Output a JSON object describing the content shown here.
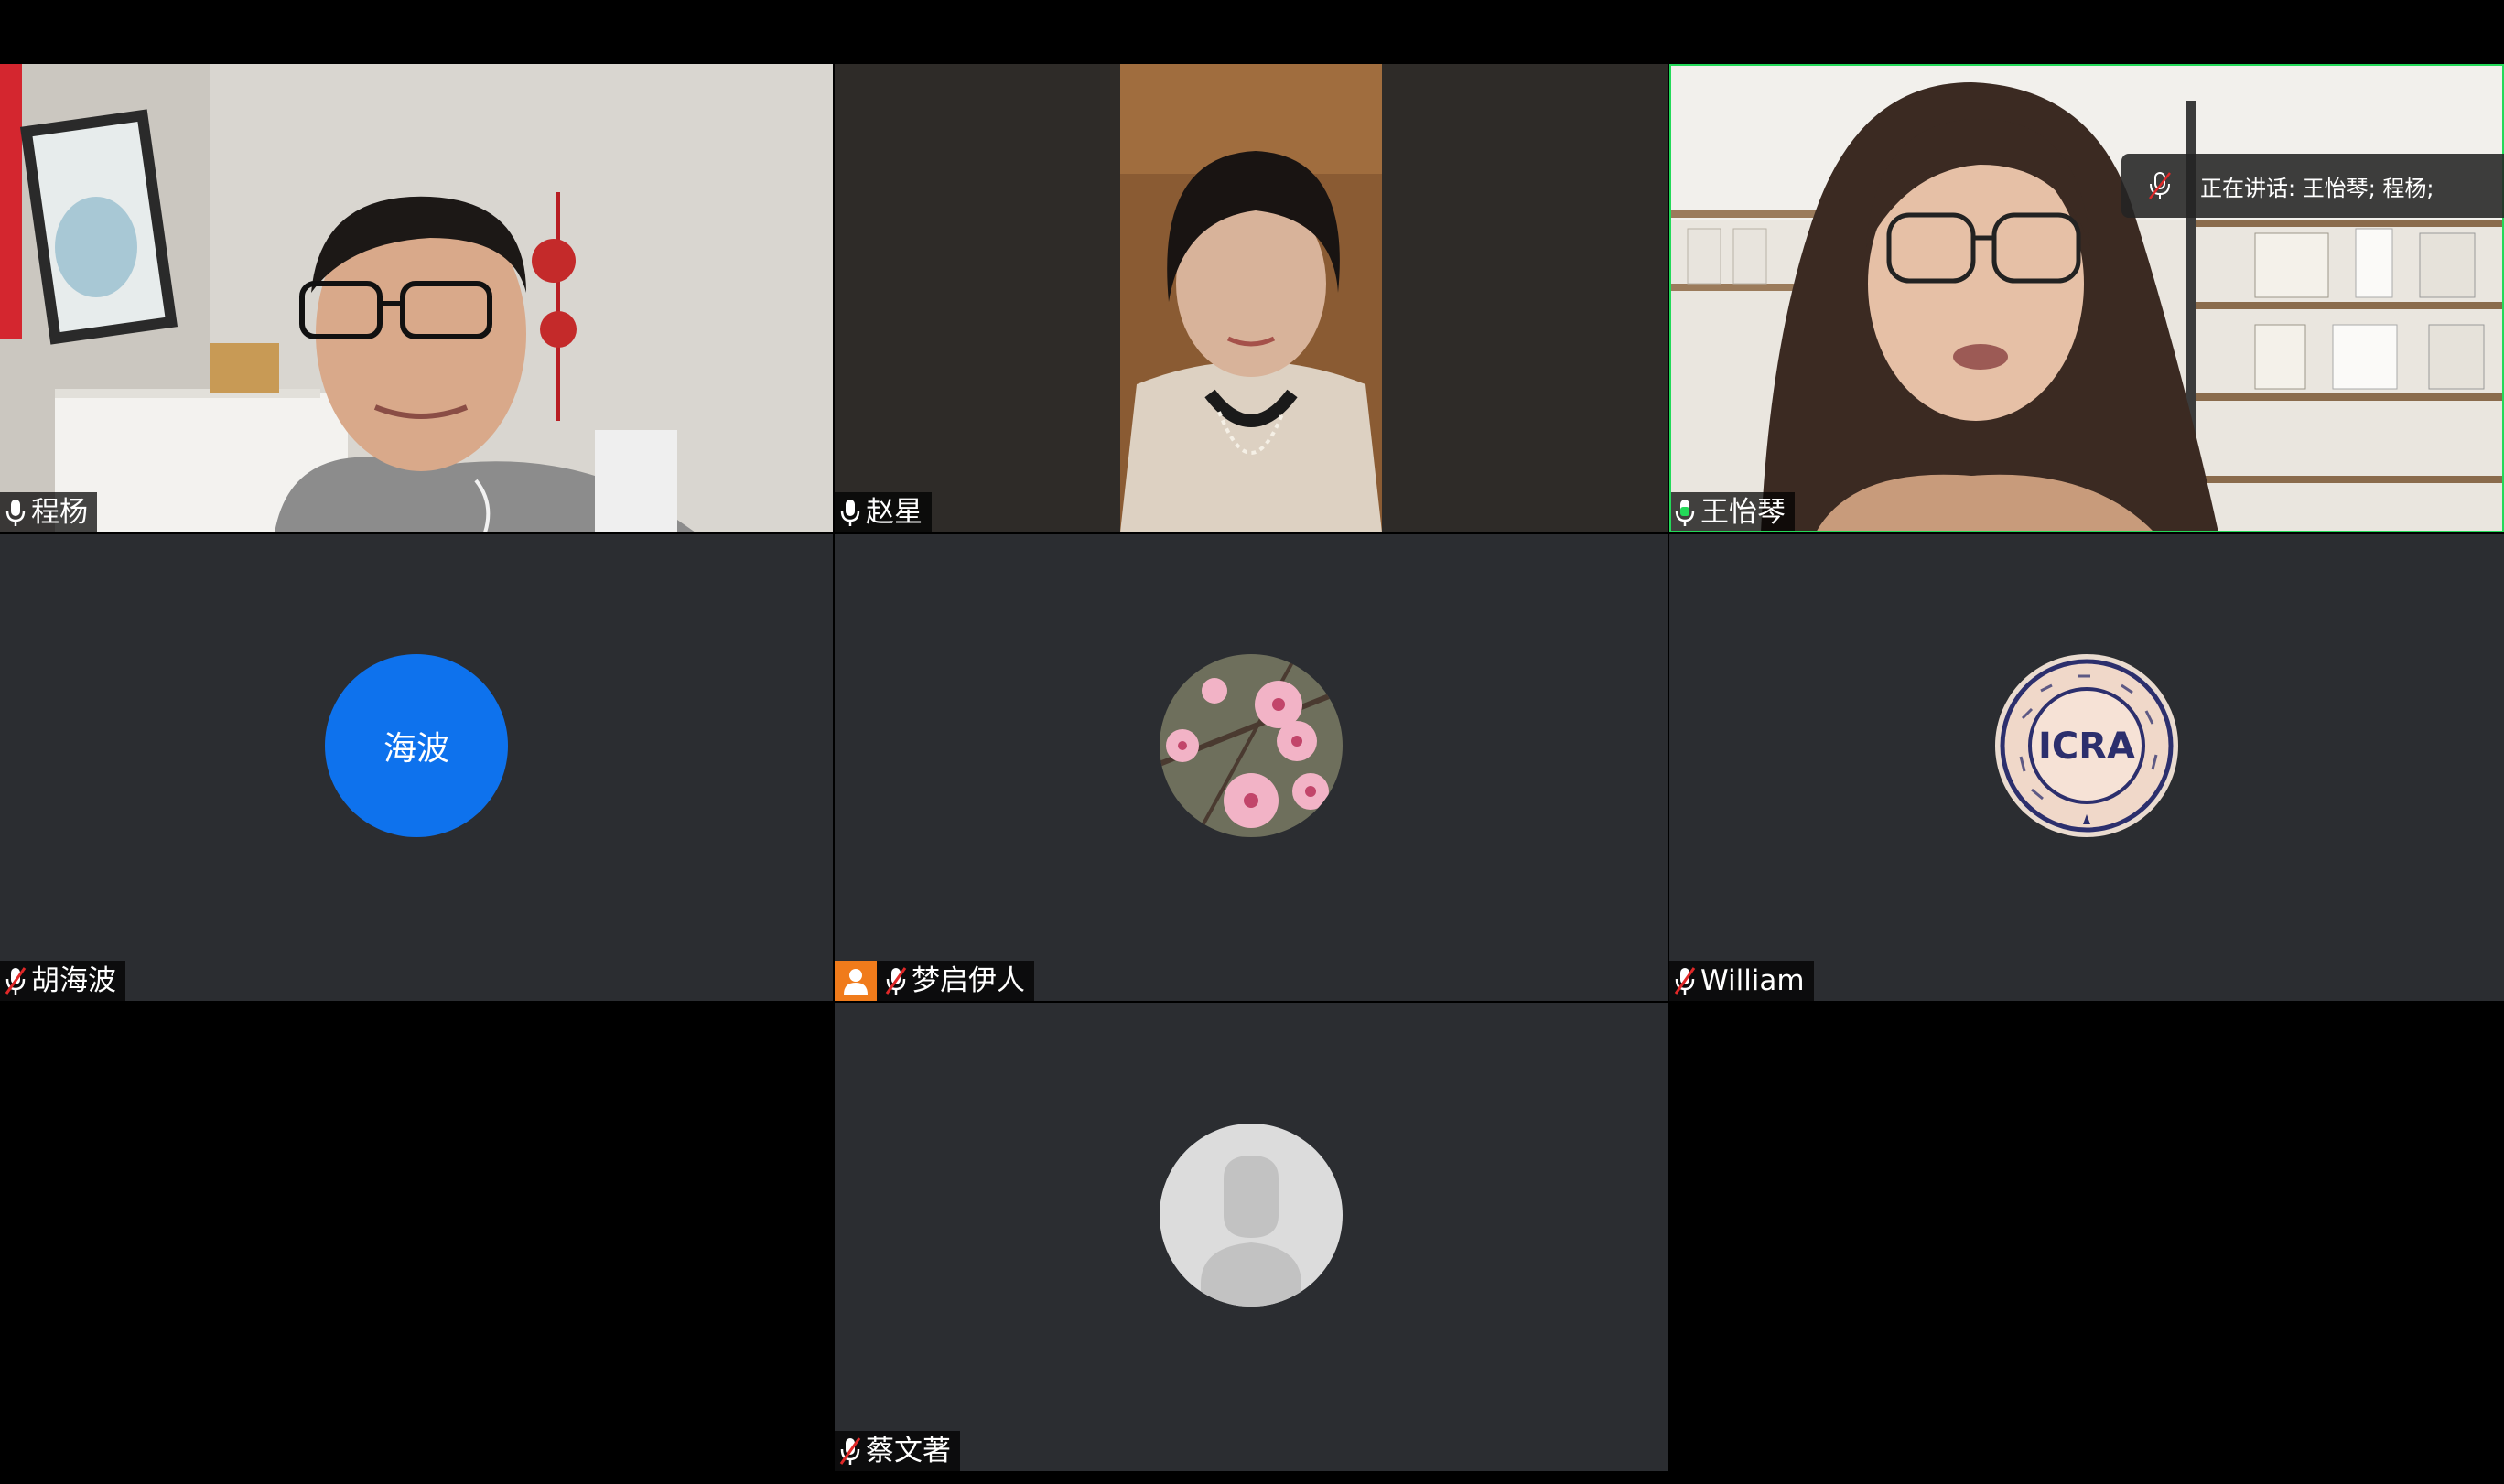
{
  "speaking_banner": {
    "label": "正在讲话: 王怡琴; 程杨;"
  },
  "participants": [
    {
      "name": "程杨",
      "mic": "on",
      "type": "video"
    },
    {
      "name": "赵星",
      "mic": "on",
      "type": "video"
    },
    {
      "name": "王怡琴",
      "mic": "on",
      "type": "video",
      "active_speaker": true
    },
    {
      "name": "胡海波",
      "mic": "muted",
      "type": "avatar-text",
      "avatar_text": "海波",
      "avatar_color": "#0e72ed"
    },
    {
      "name": "梦启伊人",
      "mic": "muted",
      "type": "avatar-image",
      "is_host": true,
      "host_badge_color": "#f07b1b"
    },
    {
      "name": "William",
      "mic": "muted",
      "type": "avatar-image",
      "avatar_logo_text": "ICRA"
    },
    {
      "name": "蔡文著",
      "mic": "muted",
      "type": "avatar-default"
    }
  ],
  "colors": {
    "tile_background": "#2b2d31",
    "active_speaker_border": "#23d959",
    "muted_icon": "#e02828"
  }
}
